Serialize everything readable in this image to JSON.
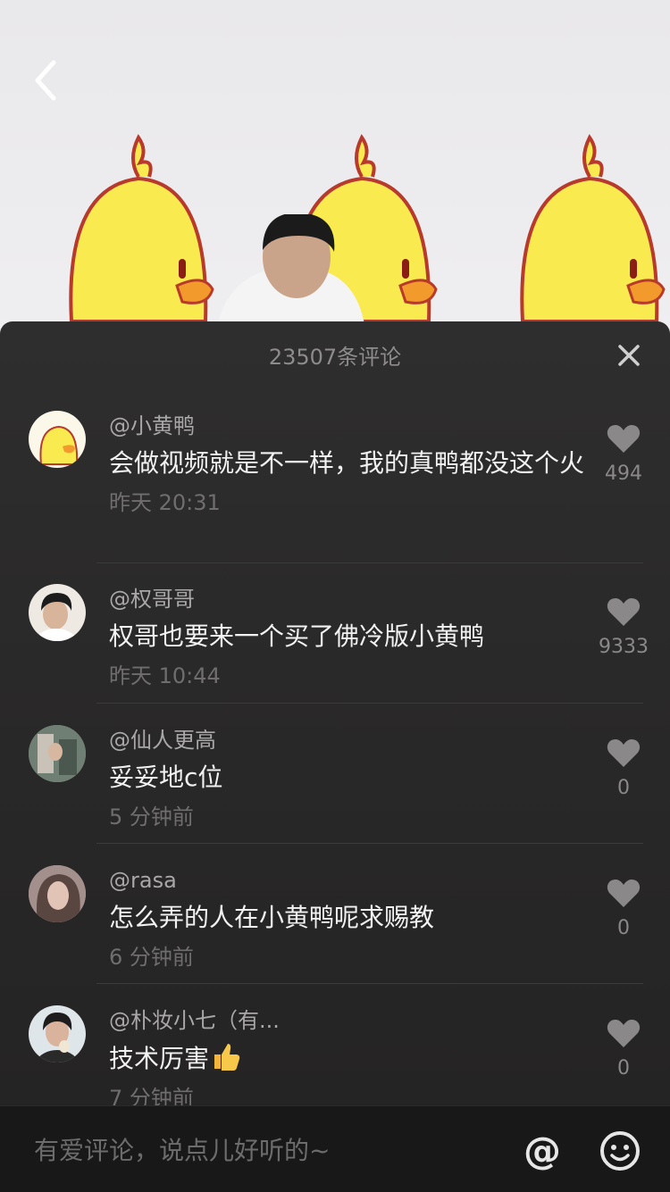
{
  "header": {
    "comment_count_title": "23507条评论"
  },
  "comments": [
    {
      "user": "@小黄鸭",
      "text": "会做视频就是不一样，我的真鸭都没这个火",
      "time": "昨天 20:31",
      "likes": "494",
      "avatar": "duck-avatar"
    },
    {
      "user": "@权哥哥",
      "text": "权哥也要来一个买了佛冷版小黄鸭",
      "time": "昨天 10:44",
      "likes": "9333",
      "avatar": "person-avatar"
    },
    {
      "user": "@仙人更高",
      "text": "妥妥地c位",
      "time": "5 分钟前",
      "likes": "0",
      "avatar": "photo-avatar"
    },
    {
      "user": "@rasa",
      "text": "怎么弄的人在小黄鸭呢求赐教",
      "time": "6 分钟前",
      "likes": "0",
      "avatar": "woman-avatar"
    },
    {
      "user": "@朴妆小七（有...",
      "text": "技术厉害",
      "time": "7 分钟前",
      "likes": "0",
      "avatar": "person-avatar"
    }
  ],
  "input": {
    "placeholder": "有爱评论，说点儿好听的~",
    "at_label": "@"
  },
  "colors": {
    "duck_yellow": "#f8ea4f",
    "sheet_bg": "#2a2929",
    "like_icon": "#8a8888"
  }
}
